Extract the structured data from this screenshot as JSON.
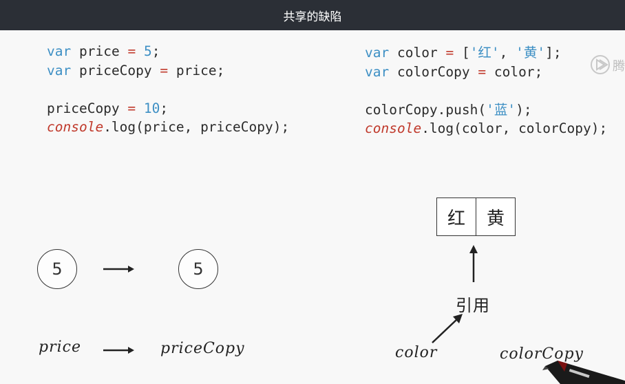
{
  "title": "共享的缺陷",
  "left_code": {
    "line1": {
      "kw": "var",
      "name": "price",
      "op": "=",
      "val": "5",
      "end": ";"
    },
    "line2": {
      "kw": "var",
      "name": "priceCopy",
      "op": "=",
      "rhs": "price;"
    },
    "line3": {
      "name": "priceCopy",
      "op": "=",
      "val": "10",
      "end": ";"
    },
    "line4": {
      "obj": "console",
      "rest": ".log(price, priceCopy);"
    }
  },
  "right_code": {
    "line1": {
      "kw": "var",
      "name": "color",
      "op": "=",
      "open": "[",
      "s1": "'红'",
      "comma": ", ",
      "s2": "'黄'",
      "close": "];"
    },
    "line2": {
      "kw": "var",
      "name": "colorCopy",
      "op": "=",
      "rhs": "color;"
    },
    "line3": {
      "pre": "colorCopy.push(",
      "s": "'蓝'",
      "post": ");"
    },
    "line4": {
      "obj": "console",
      "rest": ".log(color, colorCopy);"
    }
  },
  "diagram_left": {
    "circle_a": "5",
    "circle_b": "5",
    "label_a": "price",
    "label_b": "priceCopy"
  },
  "diagram_right": {
    "cell1": "红",
    "cell2": "黄",
    "ref_label": "引用",
    "label_a": "color",
    "label_b": "colorCopy"
  },
  "watermark": "腾"
}
